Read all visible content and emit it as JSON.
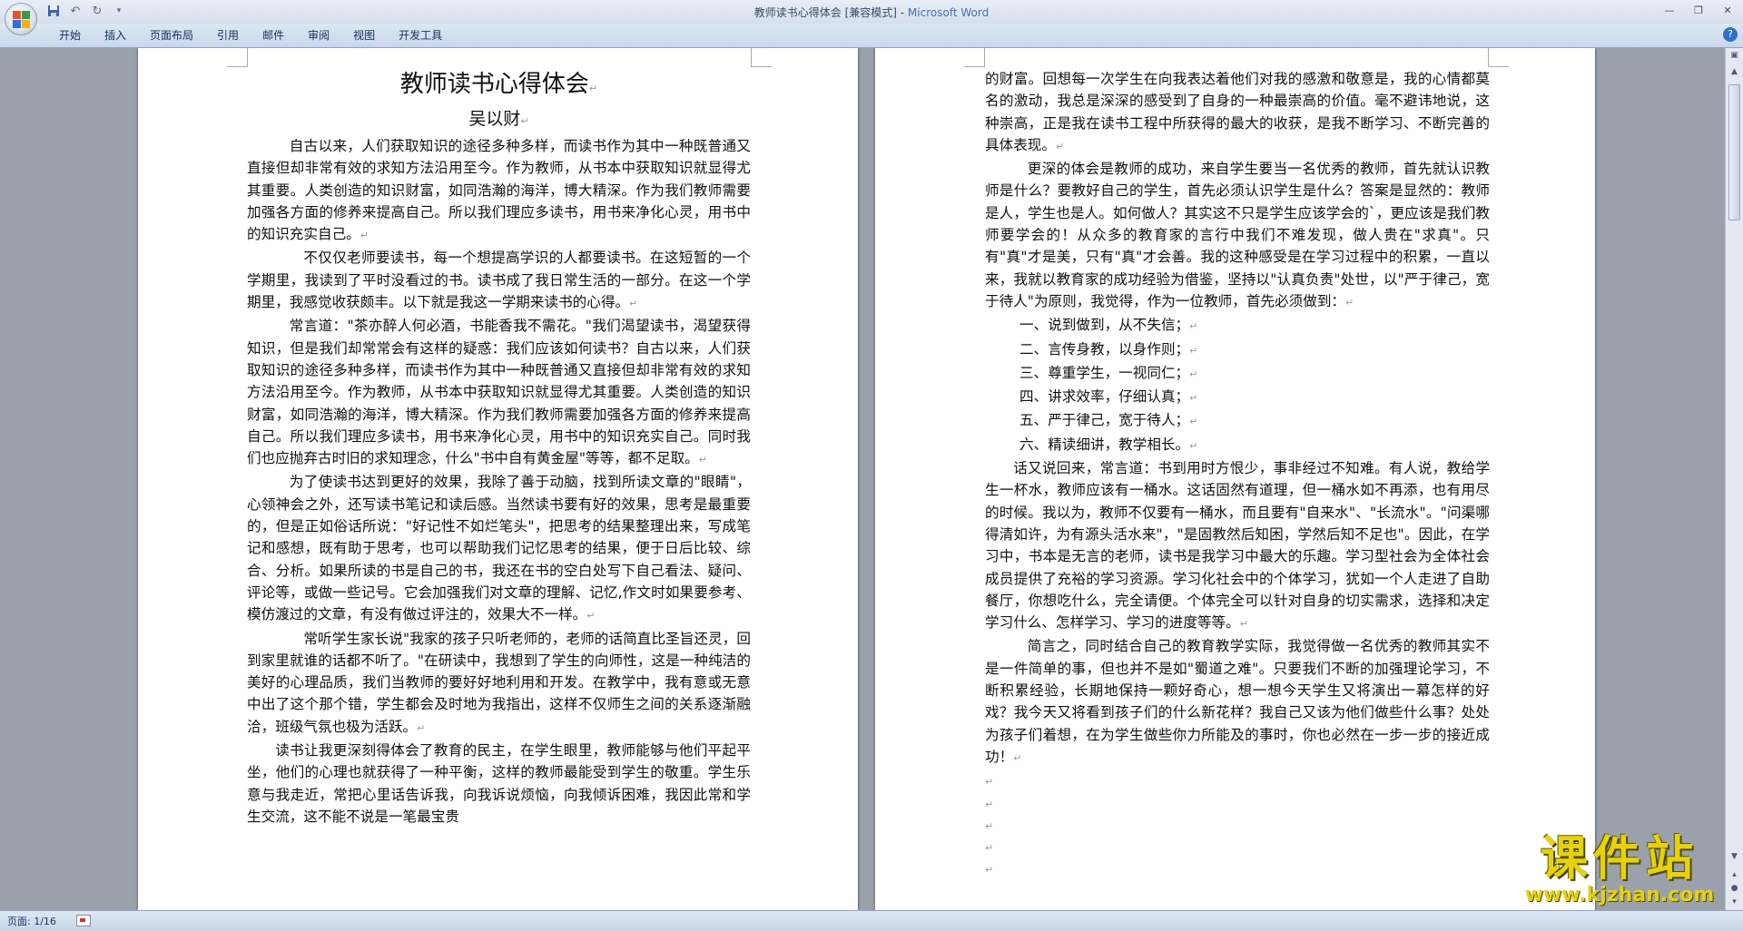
{
  "window": {
    "title_doc": "教师读书心得体会 [兼容模式] - ",
    "title_app": "Microsoft Word"
  },
  "colors": {
    "office_logo": [
      "#e8532b",
      "#3b9a3b",
      "#2f6fd6",
      "#f3b21e"
    ]
  },
  "ribbon": {
    "tabs": [
      "开始",
      "插入",
      "页面布局",
      "引用",
      "邮件",
      "审阅",
      "视图",
      "开发工具"
    ]
  },
  "status": {
    "page_count": "页面: 1/16"
  },
  "watermark": {
    "text": "课件站",
    "url": "www.kjzhan.com"
  },
  "doc": {
    "title": "教师读书心得体会",
    "author": "吴以财",
    "left": [
      "自古以来，人们获取知识的途径多种多样，而读书作为其中一种既普通又直接但却非常有效的求知方法沿用至今。作为教师，从书本中获取知识就显得尤其重要。人类创造的知识财富，如同浩瀚的海洋，博大精深。作为我们教师需要加强各方面的修养来提高自己。所以我们理应多读书，用书来净化心灵，用书中的知识充实自己。",
      "不仅仅老师要读书，每一个想提高学识的人都要读书。在这短暂的一个学期里，我读到了平时没看过的书。读书成了我日常生活的一部分。在这一个学期里，我感觉收获颇丰。以下就是我这一学期来读书的心得。",
      "常言道：\"茶亦醉人何必酒，书能香我不需花。\"我们渴望读书，渴望获得知识，但是我们却常常会有这样的疑惑：我们应该如何读书？自古以来，人们获取知识的途径多种多样，而读书作为其中一种既普通又直接但却非常有效的求知方法沿用至今。作为教师，从书本中获取知识就显得尤其重要。人类创造的知识财富，如同浩瀚的海洋，博大精深。作为我们教师需要加强各方面的修养来提高自己。所以我们理应多读书，用书来净化心灵，用书中的知识充实自己。同时我们也应抛弃古时旧的求知理念，什么\"书中自有黄金屋\"等等，都不足取。",
      "为了使读书达到更好的效果，我除了善于动脑，找到所读文章的\"眼睛\"，心领神会之外，还写读书笔记和读后感。当然读书要有好的效果，思考是最重要的，但是正如俗话所说：\"好记性不如烂笔头\"，把思考的结果整理出来，写成笔记和感想，既有助于思考，也可以帮助我们记忆思考的结果，便于日后比较、综合、分析。如果所读的书是自己的书，我还在书的空白处写下自己看法、疑问、评论等，或做一些记号。它会加强我们对文章的理解、记忆,作文时如果要参考、模仿渡过的文章，有没有做过评注的，效果大不一样。",
      "常听学生家长说\"我家的孩子只听老师的，老师的话简直比圣旨还灵，回到家里就谁的话都不听了。\"在研读中，我想到了学生的向师性，这是一种纯洁的美好的心理品质，我们当教师的要好好地利用和开发。在教学中，我有意或无意中出了这个那个错，学生都会及时地为我指出，这样不仅师生之间的关系逐渐融洽，班级气氛也极为活跃。",
      "读书让我更深刻得体会了教育的民主，在学生眼里，教师能够与他们平起平坐，他们的心理也就获得了一种平衡，这样的教师最能受到学生的敬重。学生乐意与我走近，常把心里话告诉我，向我诉说烦恼，向我倾诉困难，我因此常和学生交流，这不能不说是一笔最宝贵"
    ],
    "right": [
      "的财富。回想每一次学生在向我表达着他们对我的感激和敬意是，我的心情都莫名的激动，我总是深深的感受到了自身的一种最崇高的价值。毫不避讳地说，这种崇高，正是我在读书工程中所获得的最大的收获，是我不断学习、不断完善的具体表现。",
      "更深的体会是教师的成功，来自学生要当一名优秀的教师，首先就认识教师是什么？要教好自己的学生，首先必须认识学生是什么？答案是显然的：教师是人，学生也是人。如何做人？其实这不只是学生应该学会的`，更应该是我们教师要学会的！从众多的教育家的言行中我们不难发现，做人贵在\"求真\"。只有\"真\"才是美，只有\"真\"才会善。我的这种感受是在学习过程中的积累，一直以来，我就以教育家的成功经验为借鉴，坚持以\"认真负责\"处世，以\"严于律己，宽于待人\"为原则，我觉得，作为一位教师，首先必须做到：",
      "话又说回来，常言道：书到用时方恨少，事非经过不知难。有人说，教给学生一杯水，教师应该有一桶水。这话固然有道理，但一桶水如不再添，也有用尽的时候。我以为，教师不仅要有一桶水，而且要有\"自来水\"、\"长流水\"。\"问渠哪得清如许，为有源头活水来\"，\"是固教然后知困，学然后知不足也\"。因此，在学习中，书本是无言的老师，读书是我学习中最大的乐趣。学习型社会为全体社会成员提供了充裕的学习资源。学习化社会中的个体学习，犹如一个人走进了自助餐厅，你想吃什么，完全请便。个体完全可以针对自身的切实需求，选择和决定学习什么、怎样学习、学习的进度等等。",
      "简言之，同时结合自己的教育教学实际，我觉得做一名优秀的教师其实不是一件简单的事，但也并不是如\"蜀道之难\"。只要我们不断的加强理论学习，不断积累经验，长期地保持一颗好奇心，想一想今天学生又将演出一幕怎样的好戏？我今天又将看到孩子们的什么新花样？我自己又该为他们做些什么事？处处为孩子们着想，在为学生做些你力所能及的事时，你也必然在一步一步的接近成功！"
    ],
    "list": [
      "一、说到做到，从不失信；",
      "二、言传身教，以身作则；",
      "三、尊重学生，一视同仁；",
      "四、讲求效率，仔细认真；",
      "五、严于律己，宽于待人；",
      "六、精读细讲，教学相长。"
    ],
    "mark": "↵"
  }
}
